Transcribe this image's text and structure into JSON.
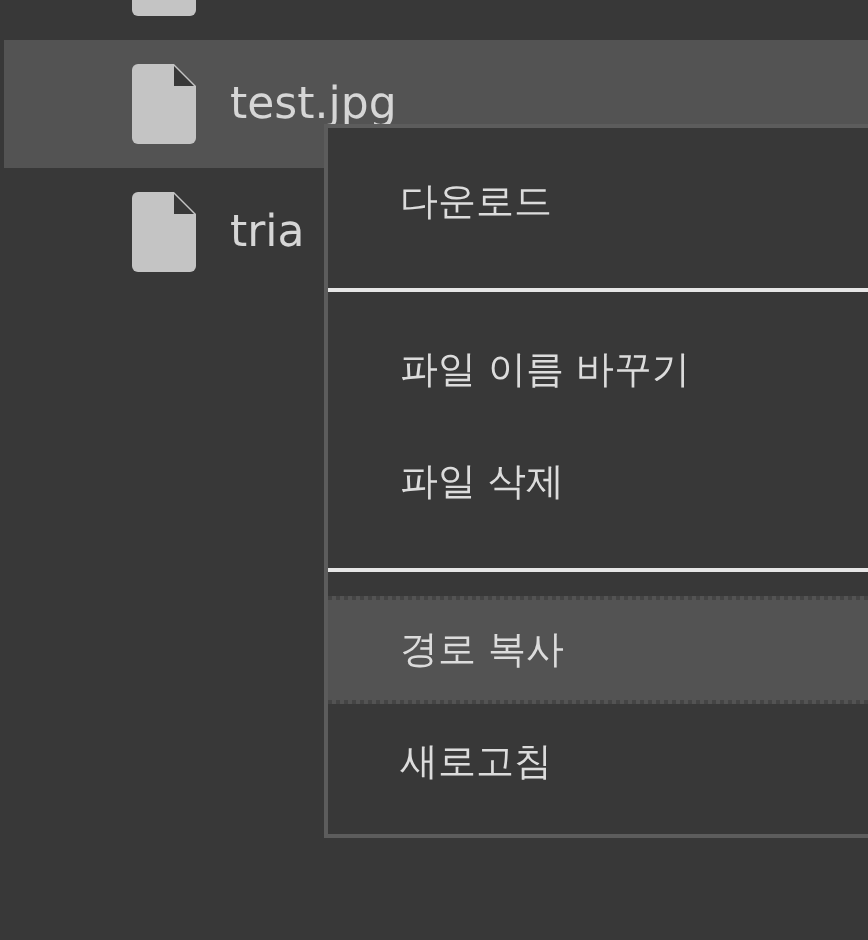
{
  "files": [
    {
      "selected": false
    },
    {
      "name": "test.jpg",
      "selected": true
    },
    {
      "name": "tria",
      "selected": false
    }
  ],
  "context_menu": {
    "items": [
      {
        "kind": "item",
        "label": "다운로드",
        "selected": false
      },
      {
        "kind": "separator"
      },
      {
        "kind": "item",
        "label": "파일 이름 바꾸기",
        "selected": false
      },
      {
        "kind": "item",
        "label": "파일 삭제",
        "selected": false
      },
      {
        "kind": "separator"
      },
      {
        "kind": "item",
        "label": "경로 복사",
        "selected": true
      },
      {
        "kind": "item",
        "label": "새로고침",
        "selected": false
      }
    ]
  }
}
